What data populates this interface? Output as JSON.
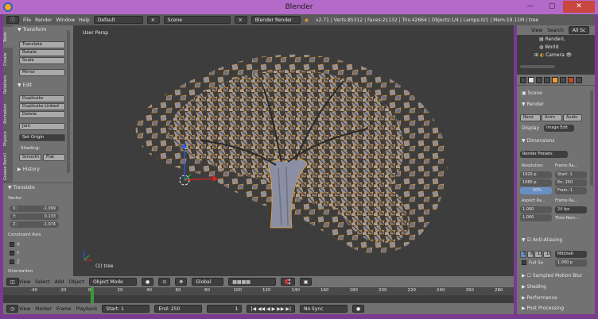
{
  "window": {
    "title": "Blender",
    "controls": [
      "—",
      "▢",
      "✕"
    ]
  },
  "infobar": {
    "menus": [
      "File",
      "Render",
      "Window",
      "Help"
    ],
    "layout": "Default",
    "scene": "Scene",
    "engine": "Blender Render",
    "stats": "v2.71 | Verts:85312 | Faces:21132 | Tris:42664 | Objects:1/4 | Lamps:0/1 | Mem:19.11M | tree"
  },
  "toolshelf": {
    "tabs": [
      "Tools",
      "Create",
      "Relations",
      "Animation",
      "Physics",
      "Grease Pencil"
    ],
    "transform_header": "Transform",
    "transform_buttons": [
      "Translate",
      "Rotate",
      "Scale"
    ],
    "mirror_label": "Mirror",
    "edit_header": "Edit",
    "edit_buttons": [
      "Duplicate",
      "Duplicate Linked",
      "Delete"
    ],
    "join_label": "Join",
    "set_origin_label": "Set Origin",
    "shading_label": "Shading:",
    "smooth_label": "Smooth",
    "flat_label": "Flat",
    "history_header": "History"
  },
  "operator": {
    "header": "Translate",
    "vector_label": "Vector",
    "x_label": "X:",
    "x_value": "-1.099",
    "y_label": "Y:",
    "y_value": "0.133",
    "z_label": "Z:",
    "z_value": "-1.074",
    "constraint_label": "Constraint Axis",
    "axes": [
      "X",
      "Y",
      "Z"
    ],
    "orientation_label": "Orientation"
  },
  "viewport": {
    "view_label": "User Persp",
    "object_label": "(1) tree"
  },
  "view3d_header": {
    "menus": [
      "View",
      "Select",
      "Add",
      "Object"
    ],
    "mode": "Object Mode",
    "orientation": "Global"
  },
  "timeline": {
    "ticks": [
      "-40",
      "-20",
      "0",
      "20",
      "40",
      "60",
      "80",
      "100",
      "120",
      "140",
      "160",
      "180",
      "200",
      "220",
      "240",
      "260",
      "280"
    ],
    "menus": [
      "View",
      "Marker",
      "Frame",
      "Playback"
    ],
    "start_label": "Start:",
    "start_value": "1",
    "end_label": "End:",
    "end_value": "250",
    "current": "1",
    "sync": "No Sync"
  },
  "outliner": {
    "menus": [
      "View",
      "Search",
      "All Sc"
    ],
    "items": [
      "RenderL",
      "World",
      "Camera"
    ]
  },
  "properties": {
    "scene_label": "Scene",
    "render_header": "Render",
    "render_buttons": [
      "Rend",
      "Anim",
      "Audio"
    ],
    "display_label": "Display",
    "display_value": "Image Edit",
    "dimensions_header": "Dimensions",
    "presets": "Render Presets",
    "resolution_label": "Resolution:",
    "frame_range_label": "Frame Ra...",
    "res_x": "1920 p",
    "res_y": "1080 p",
    "res_pct": "50%",
    "start_frame": "Start: 1",
    "end_frame": "En: 250",
    "frame_step": "Fram: 1",
    "aspect_label": "Aspect Ra...",
    "framerate_label": "Frame Ra...",
    "aspect_x": "1.000",
    "aspect_y": "1.000",
    "fps": "24 fps",
    "time_rem_label": "Time Rem...",
    "aa_header": "Anti-Aliasing",
    "aa_samples": [
      "5",
      "8",
      "11",
      "16"
    ],
    "aa_filter": "Mitchell-",
    "full_sample_label": "Full Sa",
    "aa_size": "1.000 p",
    "sampled_motion_blur": "Sampled Motion Blur",
    "shading_header": "Shading",
    "performance_header": "Performance",
    "post_processing_header": "Post Processing"
  },
  "colors": {
    "title_bar": "#b46ac8",
    "window_frame": "#7a3b8e",
    "panel": "#727272",
    "viewport_bg": "#3d3d3d",
    "selection_orange": "#f0a030",
    "mesh_fill": "#8a8fa3",
    "close_button": "#c8473e"
  }
}
